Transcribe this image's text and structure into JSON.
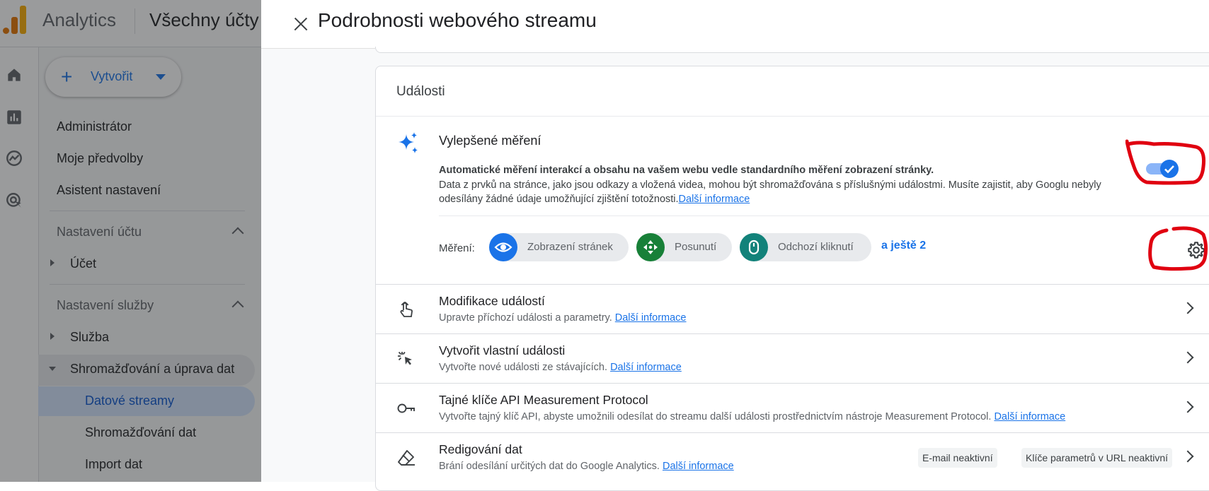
{
  "background": {
    "app_name": "Analytics",
    "account_name": "Všechny účty",
    "create_button": "Vytvořit",
    "nav": {
      "admin": "Administrátor",
      "preferences": "Moje předvolby",
      "setup_assistant": "Asistent nastavení",
      "account_settings": "Nastavení účtu",
      "account": "Účet",
      "property_settings": "Nastavení služby",
      "property": "Služba",
      "data_collection_modification": "Shromažďování a úprava dat",
      "data_streams": "Datové streamy",
      "data_collection": "Shromažďování dat",
      "data_import": "Import dat"
    }
  },
  "sheet": {
    "title": "Podrobnosti webového streamu",
    "events_card": {
      "title": "Události",
      "enhanced_measurement": {
        "title": "Vylepšené měření",
        "bold_desc": "Automatické měření interakcí a obsahu na vašem webu vedle standardního měření zobrazení stránky.",
        "desc": "Data z prvků na stránce, jako jsou odkazy a vložená videa, mohou být shromažďována s příslušnými událostmi. Musíte zajistit, aby Googlu nebyly odesílány žádné údaje umožňující zjištění totožnosti.",
        "link": "Další informace",
        "enabled": true,
        "measurement_label": "Měření:",
        "chips": [
          {
            "label": "Zobrazení stránek",
            "color": "#1a73e8",
            "icon": "eye-icon"
          },
          {
            "label": "Posunutí",
            "color": "#188038",
            "icon": "move-icon"
          },
          {
            "label": "Odchozí kliknutí",
            "color": "#12827a",
            "icon": "mouse-icon"
          }
        ],
        "more": "a ještě 2"
      },
      "rows": [
        {
          "title": "Modifikace událostí",
          "desc": "Upravte příchozí události a parametry.",
          "link": "Další informace"
        },
        {
          "title": "Vytvořit vlastní události",
          "desc": "Vytvořte nové události ze stávajících.",
          "link": "Další informace"
        },
        {
          "title": "Tajné klíče API Measurement Protocol",
          "desc": "Vytvořte tajný klíč API, abyste umožnili odesílat do streamu další události prostřednictvím nástroje Measurement Protocol.",
          "link": "Další informace"
        },
        {
          "title": "Redigování dat",
          "desc": "Brání odesílání určitých dat do Google Analytics.",
          "link": "Další informace",
          "badges": [
            "E-mail neaktivní",
            "Klíče parametrů v URL neaktivní"
          ]
        }
      ]
    }
  },
  "colors": {
    "accent": "#1a73e8",
    "annotation": "#e00010"
  }
}
